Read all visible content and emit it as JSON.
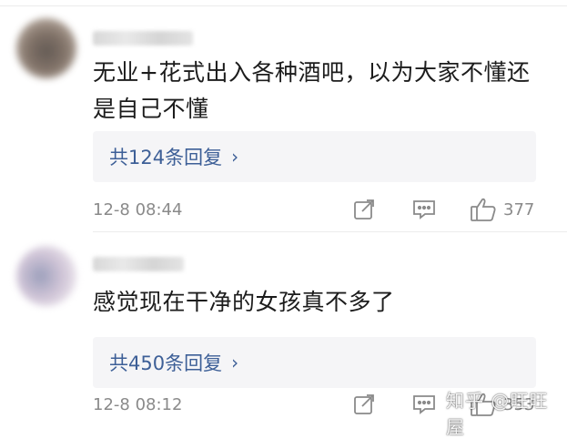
{
  "comments": [
    {
      "text": "无业+花式出入各种酒吧，以为大家不懂还是自己不懂",
      "reply_label": "共124条回复",
      "time": "12-8 08:44",
      "likes": "377"
    },
    {
      "text": "感觉现在干净的女孩真不多了",
      "reply_label": "共450条回复",
      "time": "12-8 08:12",
      "likes": "353"
    }
  ],
  "icons": {
    "reply_chevron": "›",
    "share": "share-icon",
    "comment": "comment-icon",
    "like": "thumbs-up-icon"
  },
  "watermark": "知乎 @旺旺屋",
  "colors": {
    "reply_link": "#3d5f97",
    "meta_gray": "#8a8a8a",
    "reply_bg": "#f5f5f7"
  }
}
